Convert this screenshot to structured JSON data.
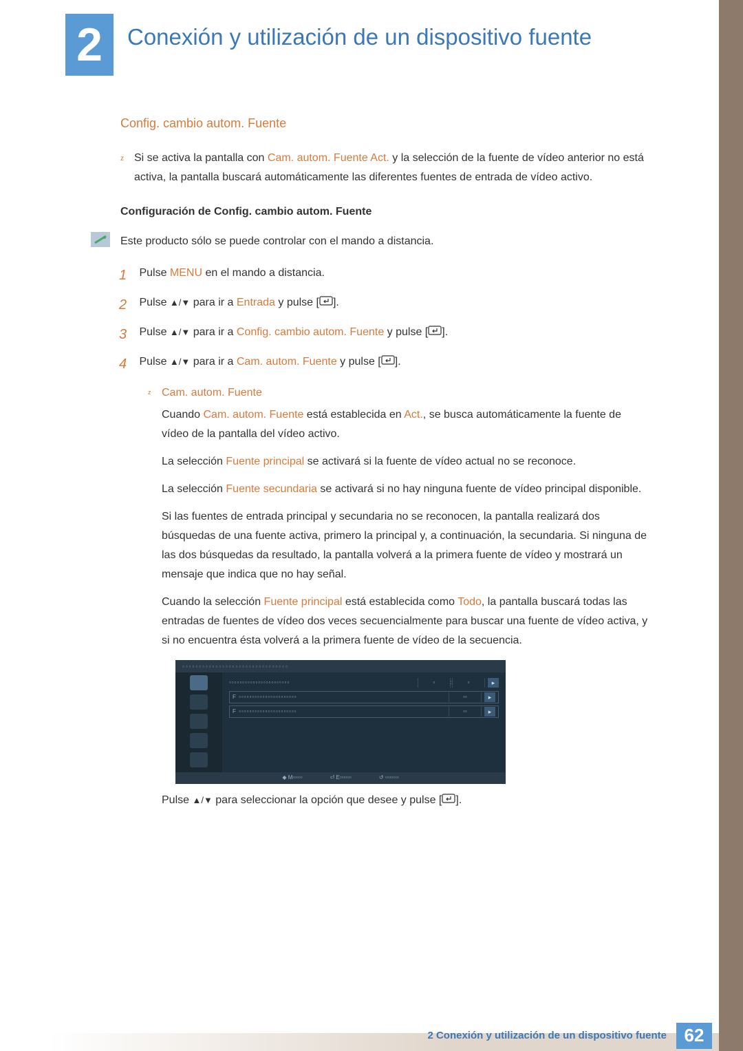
{
  "chapter": {
    "number": "2",
    "title": "Conexión y utilización de un dispositivo fuente"
  },
  "section": {
    "heading": "Config. cambio autom. Fuente"
  },
  "intro_bullet": {
    "pre": "Si se activa la pantalla con ",
    "hl": "Cam. autom. Fuente Act.",
    "post": " y la selección de la fuente de vídeo anterior no está activa, la pantalla buscará automáticamente las diferentes fuentes de entrada de vídeo activo."
  },
  "sub_heading": "Configuración de Config. cambio autom. Fuente",
  "note": "Este producto sólo se puede controlar con el mando a distancia.",
  "steps": {
    "s1": {
      "pre": "Pulse ",
      "hl": "MENU",
      "post": " en el mando a distancia."
    },
    "s2": {
      "pre": "Pulse ",
      "nav": "▲/▼",
      "mid": " para ir a ",
      "hl": "Entrada",
      "post": " y pulse [",
      "end": "]."
    },
    "s3": {
      "pre": "Pulse ",
      "nav": "▲/▼",
      "mid": " para ir a ",
      "hl": "Config. cambio autom. Fuente",
      "post": " y pulse [",
      "end": "]."
    },
    "s4": {
      "pre": "Pulse ",
      "nav": "▲/▼",
      "mid": " para ir a ",
      "hl": "Cam. autom. Fuente",
      "post": " y pulse [",
      "end": "]."
    }
  },
  "sub": {
    "title": "Cam. autom. Fuente",
    "p1": {
      "pre": "Cuando ",
      "h1": "Cam. autom. Fuente",
      "mid": " está establecida en ",
      "h2": "Act.",
      "post": ", se busca automáticamente la fuente de vídeo de la pantalla del vídeo activo."
    },
    "p2": {
      "pre": "La selección ",
      "h1": "Fuente principal",
      "post": " se activará si la fuente de vídeo actual no se reconoce."
    },
    "p3": {
      "pre": "La selección ",
      "h1": "Fuente secundaria",
      "post": " se activará si no hay ninguna fuente de vídeo principal disponible."
    },
    "p4": "Si las fuentes de entrada principal y secundaria no se reconocen, la pantalla realizará dos búsquedas de una fuente activa, primero la principal y, a continuación, la secundaria. Si ninguna de las dos búsquedas da resultado, la pantalla volverá a la primera fuente de vídeo y mostrará un mensaje que indica que no hay señal.",
    "p5": {
      "pre": "Cuando la selección ",
      "h1": "Fuente principal",
      "mid": " está establecida como ",
      "h2": "Todo",
      "post": ", la pantalla buscará todas las entradas de fuentes de vídeo dos veces secuencialmente para buscar una fuente de vídeo activa, y si no encuentra ésta volverá a la primera fuente de vídeo de la secuencia."
    }
  },
  "after_panel": {
    "pre": "Pulse ",
    "nav": "▲/▼",
    "mid": " para seleccionar la opción que desee y pulse [",
    "end": "]."
  },
  "footer": {
    "text": "2 Conexión y utilización de un dispositivo fuente",
    "page": "62"
  },
  "osd": {
    "bar_m": "M",
    "bar_e": "E"
  }
}
